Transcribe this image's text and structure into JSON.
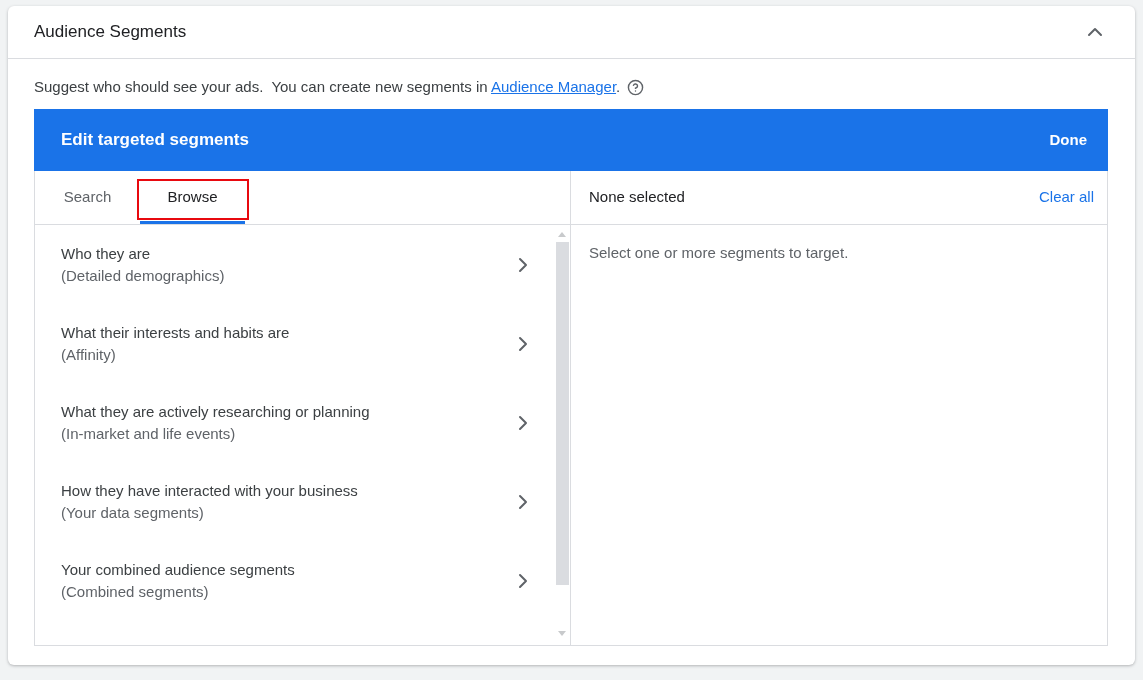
{
  "section": {
    "title": "Audience Segments",
    "expanded": true
  },
  "description": {
    "text": "Suggest who should see your ads.  You can create new segments in ",
    "link": "Audience Manager",
    "trailing": "."
  },
  "editor": {
    "title": "Edit targeted segments",
    "done": "Done",
    "tabs": [
      {
        "label": "Search",
        "selected": false,
        "highlighted": false
      },
      {
        "label": "Browse",
        "selected": true,
        "highlighted": true
      }
    ],
    "categories": [
      {
        "title": "Who they are",
        "subtitle": "(Detailed demographics)"
      },
      {
        "title": "What their interests and habits are",
        "subtitle": "(Affinity)"
      },
      {
        "title": "What they are actively researching or planning",
        "subtitle": "(In-market and life events)"
      },
      {
        "title": "How they have interacted with your business",
        "subtitle": "(Your data segments)"
      },
      {
        "title": "Your combined audience segments",
        "subtitle": "(Combined segments)"
      }
    ],
    "selection": {
      "status": "None selected",
      "clear": "Clear all",
      "hint": "Select one or more segments to target."
    }
  }
}
